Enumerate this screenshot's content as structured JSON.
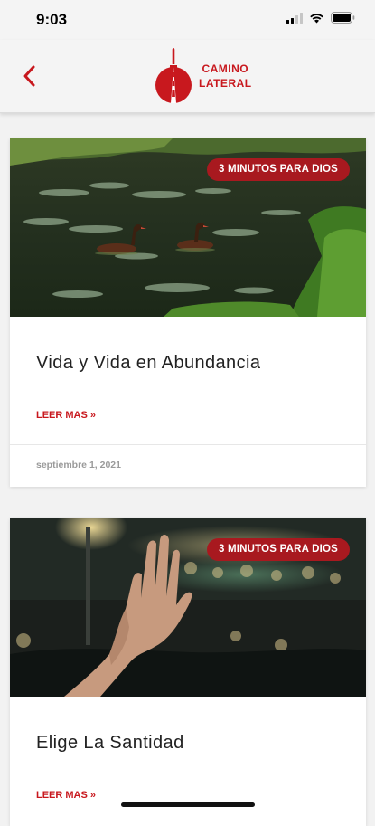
{
  "status_bar": {
    "time": "9:03"
  },
  "header": {
    "logo_line1": "CAMINO",
    "logo_line2": "LATERAL",
    "brand_color": "#c8181e"
  },
  "posts": [
    {
      "badge": "3 MINUTOS PARA DIOS",
      "title": "Vida y Vida en Abundancia",
      "read_more": "LEER MAS »",
      "date": "septiembre 1, 2021",
      "image": "ducks-pond-photo"
    },
    {
      "badge": "3 MINUTOS PARA DIOS",
      "title": "Elige La Santidad",
      "read_more": "LEER MAS »",
      "image": "raised-hand-worship-photo"
    }
  ]
}
